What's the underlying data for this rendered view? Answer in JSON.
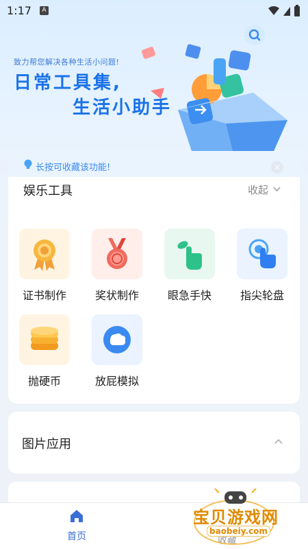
{
  "status_bar": {
    "time": "1:17",
    "notif_letter": "A"
  },
  "hero": {
    "subtitle": "致力帮您解决各种生活小问题!",
    "title_line1": "日常工具集,",
    "title_line2": "生活小助手"
  },
  "tip": {
    "text": "长按可收藏该功能!"
  },
  "entertainment": {
    "title": "娱乐工具",
    "collapse_label": "收起",
    "tools": [
      {
        "label": "证书制作",
        "icon": "certificate-medal-icon",
        "bg": "#fff4e2"
      },
      {
        "label": "奖状制作",
        "icon": "award-medal-icon",
        "bg": "#ffeeea"
      },
      {
        "label": "眼急手快",
        "icon": "quick-tap-icon",
        "bg": "#e8f8f0"
      },
      {
        "label": "指尖轮盘",
        "icon": "finger-touch-icon",
        "bg": "#eaf3ff"
      },
      {
        "label": "抛硬币",
        "icon": "coin-stack-icon",
        "bg": "#fff4e2"
      },
      {
        "label": "放屁模拟",
        "icon": "bubble-icon",
        "bg": "#eaf3ff"
      }
    ]
  },
  "images_section": {
    "title": "图片应用"
  },
  "bottom_nav": {
    "home_label": "首页",
    "fav_label": "收藏"
  },
  "watermark": {
    "text": "宝贝游戏网",
    "url": "baobeiy.com"
  },
  "colors": {
    "accent": "#1a72e8",
    "nav_active": "#3b6fd6"
  }
}
